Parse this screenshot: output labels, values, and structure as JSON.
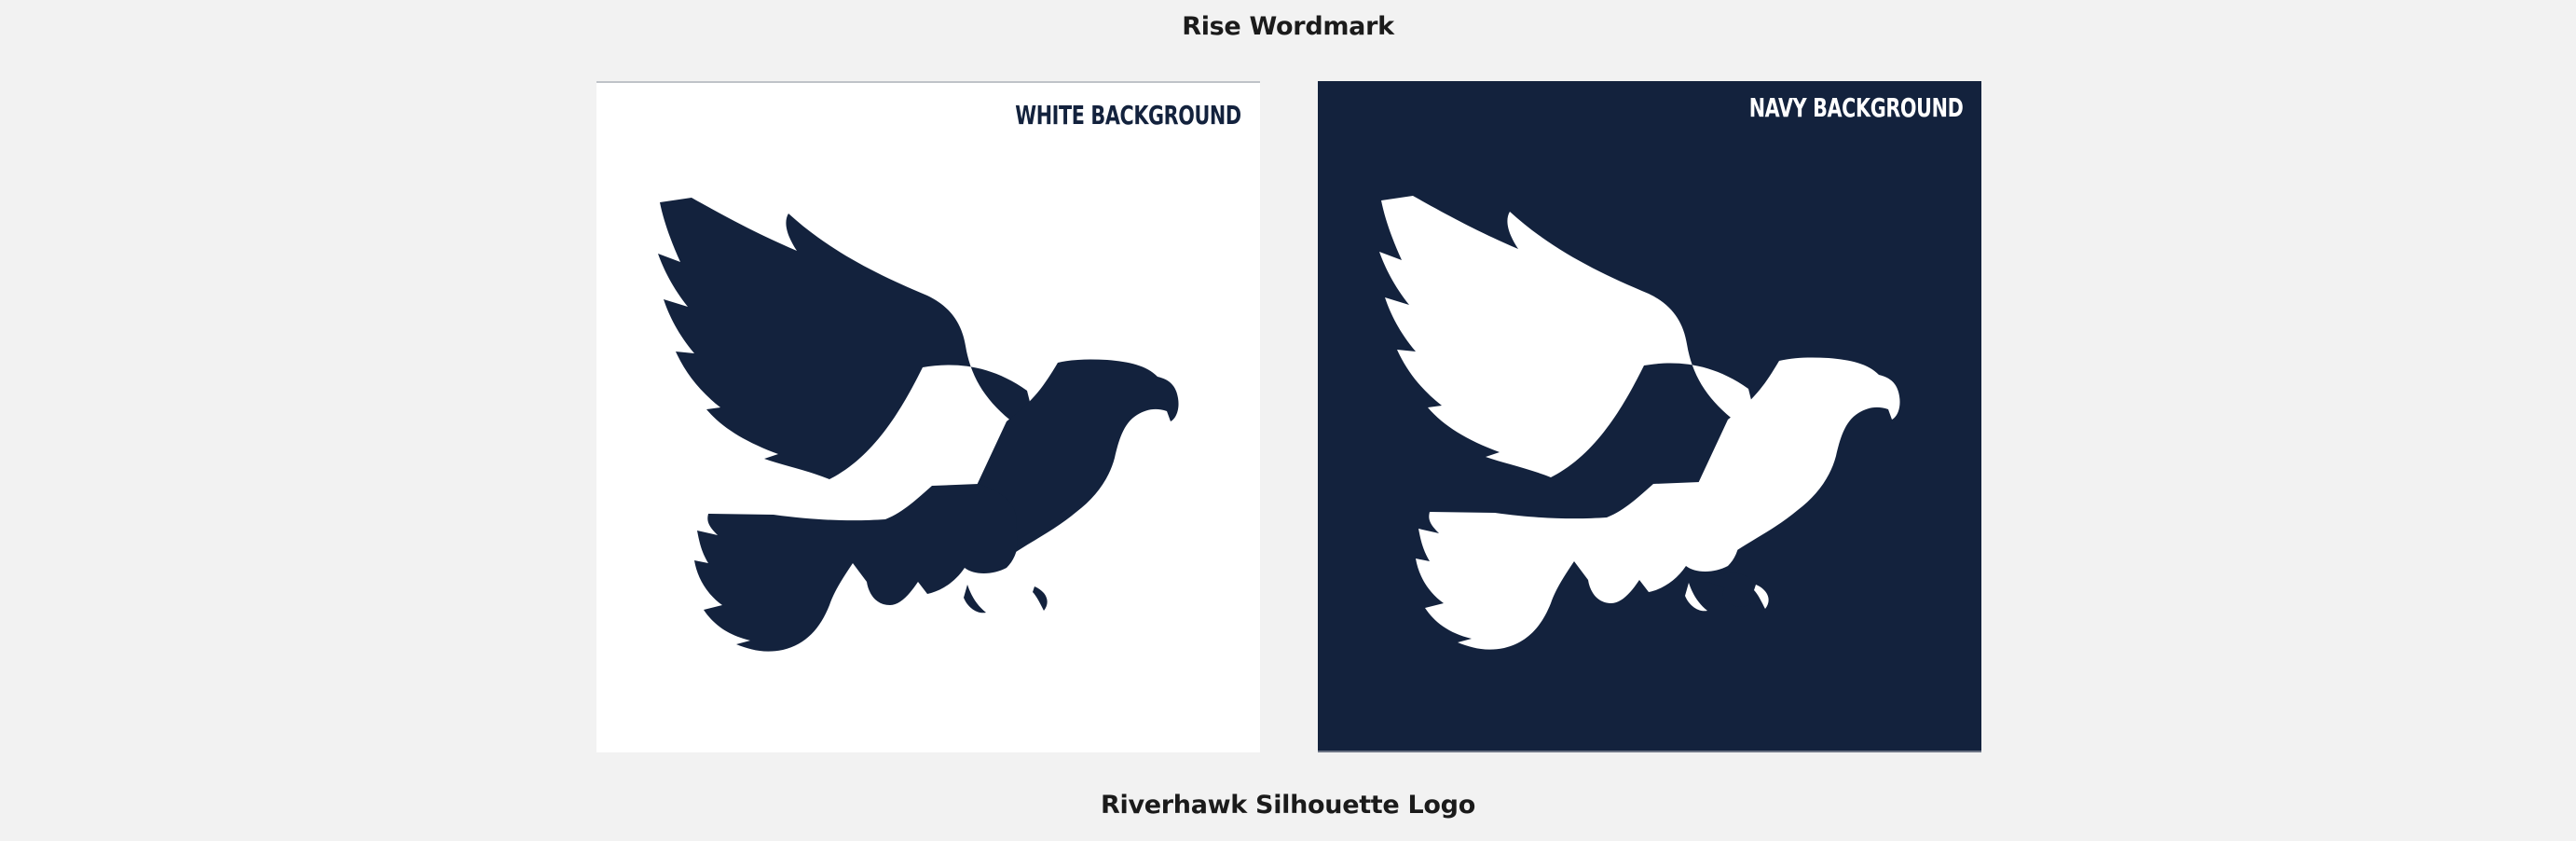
{
  "headings": {
    "top": "Rise Wordmark",
    "bottom": "Riverhawk Silhouette Logo"
  },
  "panels": [
    {
      "label": "WHITE BACKGROUND",
      "background": "#ffffff",
      "logo_color": "#13223d"
    },
    {
      "label": "NAVY BACKGROUND",
      "background": "#13223d",
      "logo_color": "#ffffff"
    }
  ],
  "colors": {
    "page_background": "#f2f2f2",
    "navy": "#13223d",
    "white": "#ffffff",
    "text": "#1b1b1b"
  },
  "icons": {
    "logo": "riverhawk-silhouette-icon"
  }
}
